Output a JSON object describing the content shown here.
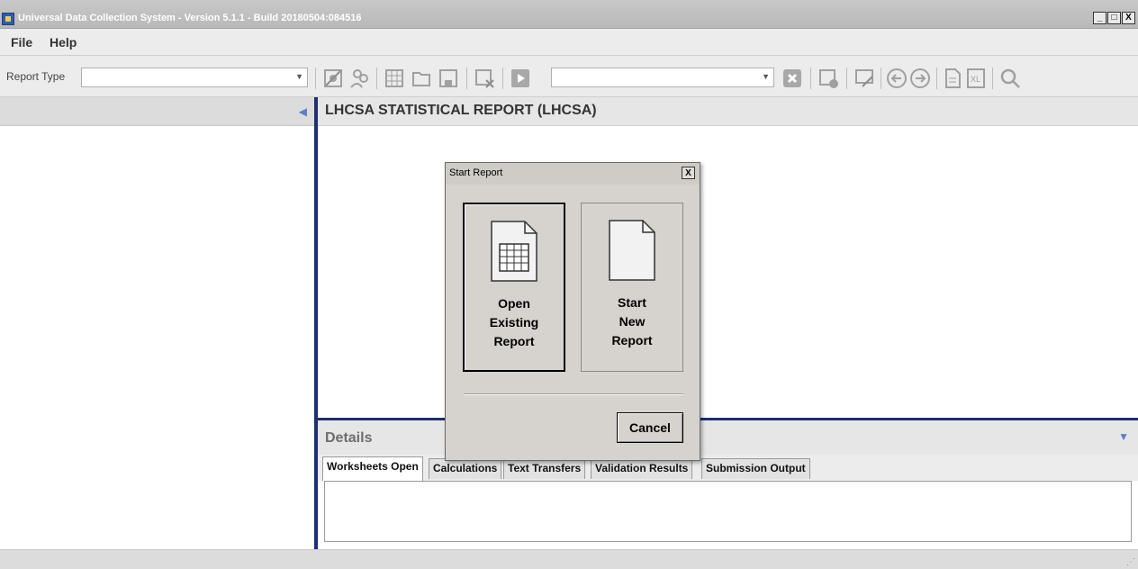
{
  "window": {
    "title": "Universal Data Collection System - Version 5.1.1 - Build 20180504:084516",
    "controls": {
      "minimize": "_",
      "maximize": "□",
      "close": "X"
    }
  },
  "menu": {
    "items": [
      "File",
      "Help"
    ]
  },
  "toolbar": {
    "report_type_label": "Report Type",
    "report_type_value": "",
    "secondary_combo_value": "",
    "icons": [
      "settings-icon",
      "users-icon",
      "grid-icon",
      "folder-icon",
      "save-icon",
      "delete-sheet-icon",
      "play-icon",
      "cancel-icon",
      "validate-icon",
      "edit-icon",
      "back-icon",
      "forward-icon",
      "export-pdf-icon",
      "export-excel-icon",
      "search-icon"
    ]
  },
  "main": {
    "report_title": "LHCSA STATISTICAL REPORT (LHCSA)"
  },
  "details": {
    "title": "Details",
    "tabs": [
      "Worksheets Open",
      "Calculations",
      "Text Transfers",
      "Validation Results",
      "Submission Output"
    ],
    "active_tab": "Worksheets Open"
  },
  "dialog": {
    "title": "Start Report",
    "open_existing": {
      "line1": "Open",
      "line2": "Existing",
      "line3": "Report"
    },
    "start_new": {
      "line1": "Start",
      "line2": "New",
      "line3": "Report"
    },
    "cancel_label": "Cancel"
  },
  "colors": {
    "accent": "#1e2f6e",
    "arrow": "#5b7fc0"
  }
}
